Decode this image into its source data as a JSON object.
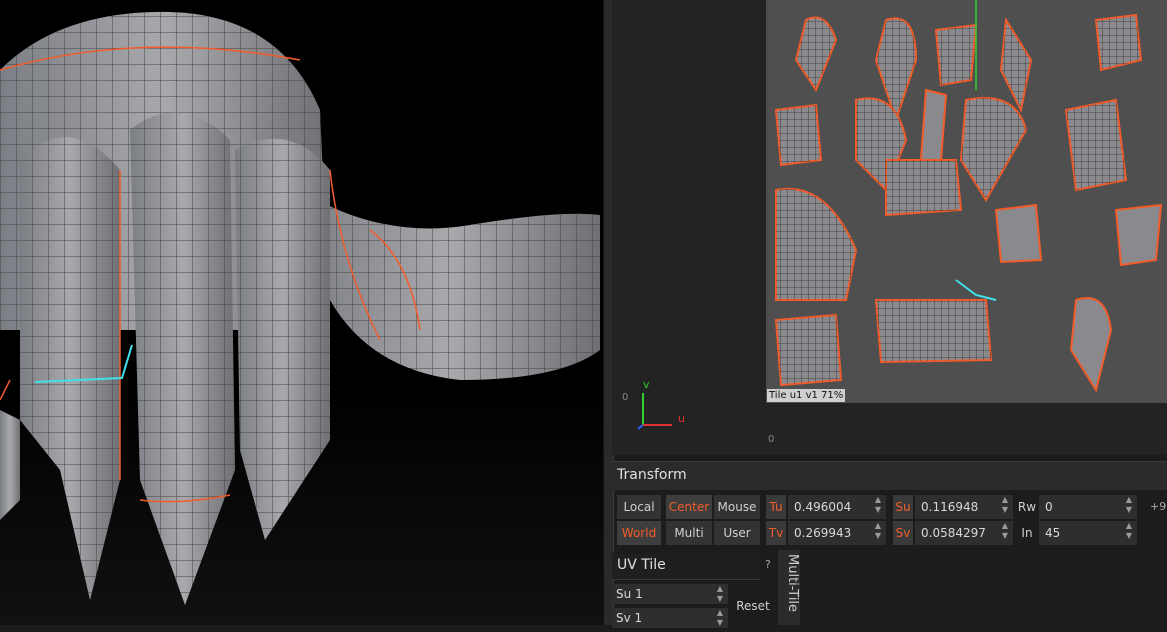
{
  "uv_view": {
    "tile_label": "Tile u1  v1  71%",
    "ruler_zero_left": "0",
    "ruler_zero_bottom": "0",
    "axis_v": "v",
    "axis_u": "u"
  },
  "transform": {
    "title": "Transform",
    "modes_row1": [
      "Local",
      "Center",
      "Mouse"
    ],
    "modes_row2": [
      "World",
      "Multi",
      "User"
    ],
    "tu_label": "Tu",
    "tu_value": "0.496004",
    "tv_label": "Tv",
    "tv_value": "0.269943",
    "su_label": "Su",
    "su_value": "0.116948",
    "sv_label": "Sv",
    "sv_value": "0.0584297",
    "rw_label": "Rw",
    "rw_value": "0",
    "in_label": "In",
    "in_value": "45",
    "overflow": "+9"
  },
  "uv_tile": {
    "title": "UV Tile",
    "help": "?",
    "su_label": "Su",
    "su_value": "1",
    "sv_label": "Sv",
    "sv_value": "1",
    "reset": "Reset",
    "multitile": "Multi-Tile"
  },
  "colors": {
    "accent": "#f25c2a",
    "seam_cyan": "#3fe0e8",
    "mesh": "#8e8e93"
  }
}
